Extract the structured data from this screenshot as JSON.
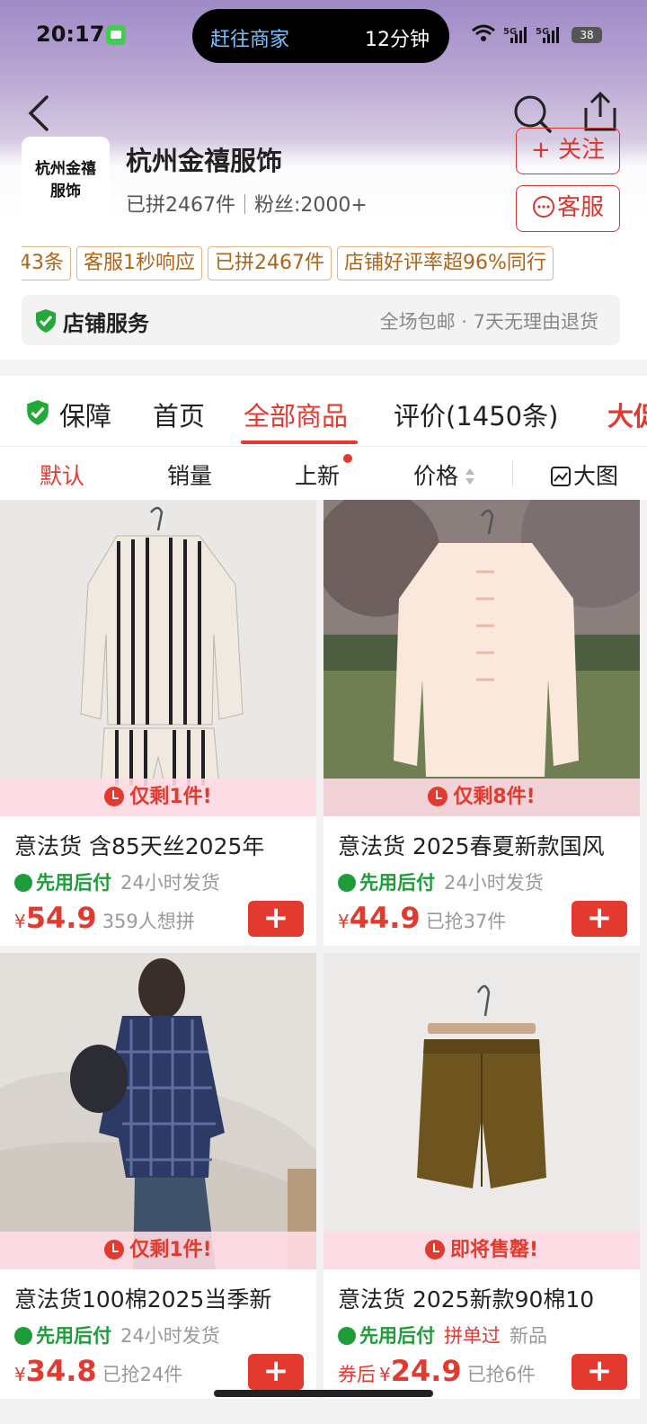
{
  "status_bar": {
    "time": "20:17",
    "island_left": "赶往商家",
    "island_right": "12分钟",
    "net1": "5G",
    "net2": "5G",
    "battery": "38"
  },
  "shop": {
    "logo_line1": "杭州金禧",
    "logo_line2": "服饰",
    "name": "杭州金禧服饰",
    "sold": "已拼2467件",
    "fans": "粉丝:2000+",
    "follow_label": "+ 关注",
    "service_label": "客服"
  },
  "tags": [
    "43条",
    "客服1秒响应",
    "已拼2467件",
    "店铺好评率超96%同行"
  ],
  "store_service": {
    "title": "店铺服务",
    "desc": "全场包邮 · 7天无理由退货"
  },
  "tabs": [
    {
      "label": "保障"
    },
    {
      "label": "首页"
    },
    {
      "label": "全部商品"
    },
    {
      "label": "评价(1450条)"
    },
    {
      "label": "大促"
    }
  ],
  "sorts": [
    "默认",
    "销量",
    "上新",
    "价格",
    "大图"
  ],
  "products": [
    {
      "badge": "仅剩1件!",
      "title": "意法货 含85天丝2025年",
      "tag1": "先用后付",
      "tag2": "24小时发货",
      "tag2_red": false,
      "prefix": "",
      "price": "54.9",
      "note": "359人想拼"
    },
    {
      "badge": "仅剩8件!",
      "title": "意法货 2025春夏新款国风",
      "tag1": "先用后付",
      "tag2": "24小时发货",
      "tag2_red": false,
      "prefix": "",
      "price": "44.9",
      "note": "已抢37件"
    },
    {
      "badge": "仅剩1件!",
      "title": "意法货100棉2025当季新",
      "tag1": "先用后付",
      "tag2": "24小时发货",
      "tag2_red": false,
      "prefix": "",
      "price": "34.8",
      "note": "已抢24件"
    },
    {
      "badge": "即将售罄!",
      "title": "意法货 2025新款90棉10",
      "tag1": "先用后付",
      "tag2": "拼单过",
      "tag3": "新品",
      "tag2_red": true,
      "prefix": "券后",
      "price": "24.9",
      "note": "已抢6件"
    }
  ],
  "currency": "¥"
}
